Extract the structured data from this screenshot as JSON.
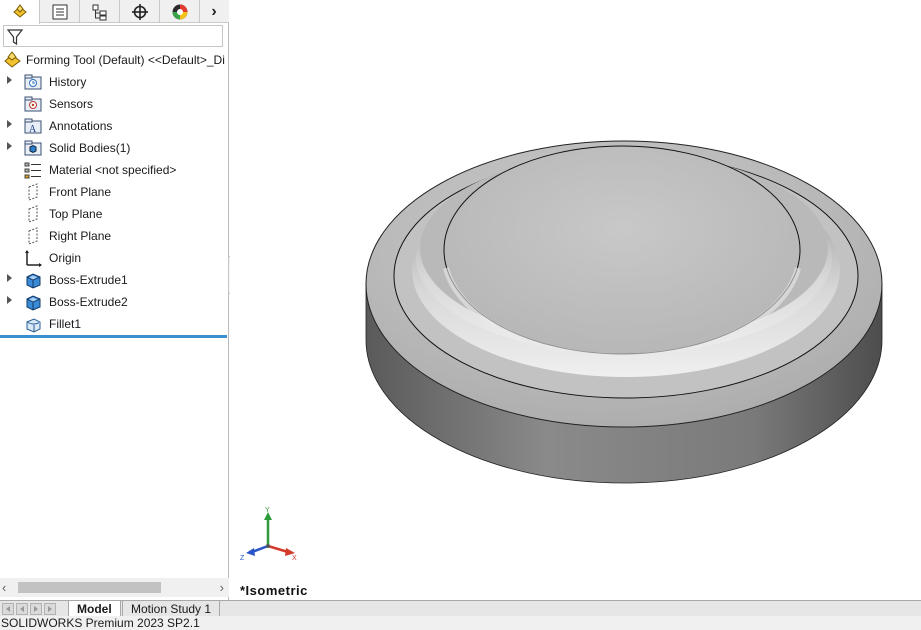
{
  "manager_tabs": [
    {
      "name": "featuremanager-tab",
      "icon": "part-icon"
    },
    {
      "name": "propertymanager-tab",
      "icon": "property-list-icon"
    },
    {
      "name": "configurationmanager-tab",
      "icon": "configuration-icon"
    },
    {
      "name": "dimxpert-tab",
      "icon": "crosshair-icon"
    },
    {
      "name": "display-manager-tab",
      "icon": "appearance-sphere-icon"
    }
  ],
  "tree": {
    "root_label": "Forming Tool (Default) <<Default>_Di",
    "items": [
      {
        "label": "History",
        "expandable": true,
        "icon": "history-folder-icon"
      },
      {
        "label": "Sensors",
        "expandable": false,
        "icon": "sensors-folder-icon"
      },
      {
        "label": "Annotations",
        "expandable": true,
        "icon": "annotations-folder-icon"
      },
      {
        "label": "Solid Bodies(1)",
        "expandable": true,
        "icon": "solid-bodies-folder-icon"
      },
      {
        "label": "Material <not specified>",
        "expandable": false,
        "icon": "material-icon"
      },
      {
        "label": "Front Plane",
        "expandable": false,
        "icon": "plane-icon"
      },
      {
        "label": "Top Plane",
        "expandable": false,
        "icon": "plane-icon"
      },
      {
        "label": "Right Plane",
        "expandable": false,
        "icon": "plane-icon"
      },
      {
        "label": "Origin",
        "expandable": false,
        "icon": "origin-icon"
      },
      {
        "label": "Boss-Extrude1",
        "expandable": true,
        "icon": "extrude-feature-icon"
      },
      {
        "label": "Boss-Extrude2",
        "expandable": true,
        "icon": "extrude-feature-icon"
      },
      {
        "label": "Fillet1",
        "expandable": false,
        "icon": "fillet-feature-icon"
      }
    ]
  },
  "viewport": {
    "view_name": "*Isometric",
    "triad": {
      "x": "X",
      "y": "Y",
      "z": "Z"
    }
  },
  "bottom_tabs": [
    {
      "label": "Model",
      "active": true
    },
    {
      "label": "Motion Study 1",
      "active": false
    }
  ],
  "status_bar": "SOLIDWORKS Premium 2023 SP2.1",
  "colors": {
    "rollback_bar": "#3a8fd0",
    "triad_x": "#d43a2a",
    "triad_y": "#2f9a3a",
    "triad_z": "#2a55c8"
  }
}
